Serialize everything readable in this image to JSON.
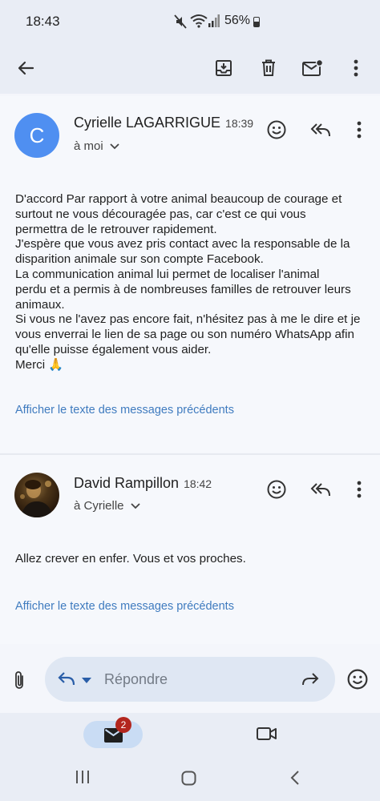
{
  "status_bar": {
    "time": "18:43",
    "battery": "56%"
  },
  "toolbar": {
    "back_icon": "arrow-left-icon",
    "archive_icon": "archive-icon",
    "delete_icon": "trash-icon",
    "mark_unread_icon": "mail-unread-icon",
    "more_icon": "more-vert-icon"
  },
  "messages": [
    {
      "avatar_letter": "C",
      "sender": "Cyrielle LAGARRIGUE",
      "time": "18:39",
      "recipient": "à moi",
      "body": [
        "D'accord Par rapport à votre animal beaucoup de courage et",
        "surtout ne vous découragée pas, car c'est ce qui vous",
        "permettra de le retrouver rapidement.",
        "J'espère que vous avez pris contact avec la responsable de la",
        "disparition animale sur son compte Facebook.",
        "La communication animal lui permet de localiser l'animal",
        "perdu et a permis à de nombreuses familles de retrouver leurs",
        "animaux.",
        "Si vous ne l'avez pas encore fait, n'hésitez pas à me le dire et je",
        "vous enverrai le lien de sa page ou son numéro WhatsApp afin",
        "qu'elle puisse également vous aider.",
        "Merci 🙏"
      ],
      "show_quoted": "Afficher le texte des messages précédents"
    },
    {
      "sender": "David Rampillon",
      "time": "18:42",
      "recipient": "à Cyrielle",
      "body": [
        "Allez crever en enfer. Vous et vos proches."
      ],
      "show_quoted": "Afficher le texte des messages précédents"
    }
  ],
  "reply_bar": {
    "placeholder": "Répondre"
  },
  "bottom_nav": {
    "mail_badge": "2"
  },
  "colors": {
    "accent": "#4f8ff1",
    "link": "#3f7bbf",
    "badge": "#b3261e"
  }
}
